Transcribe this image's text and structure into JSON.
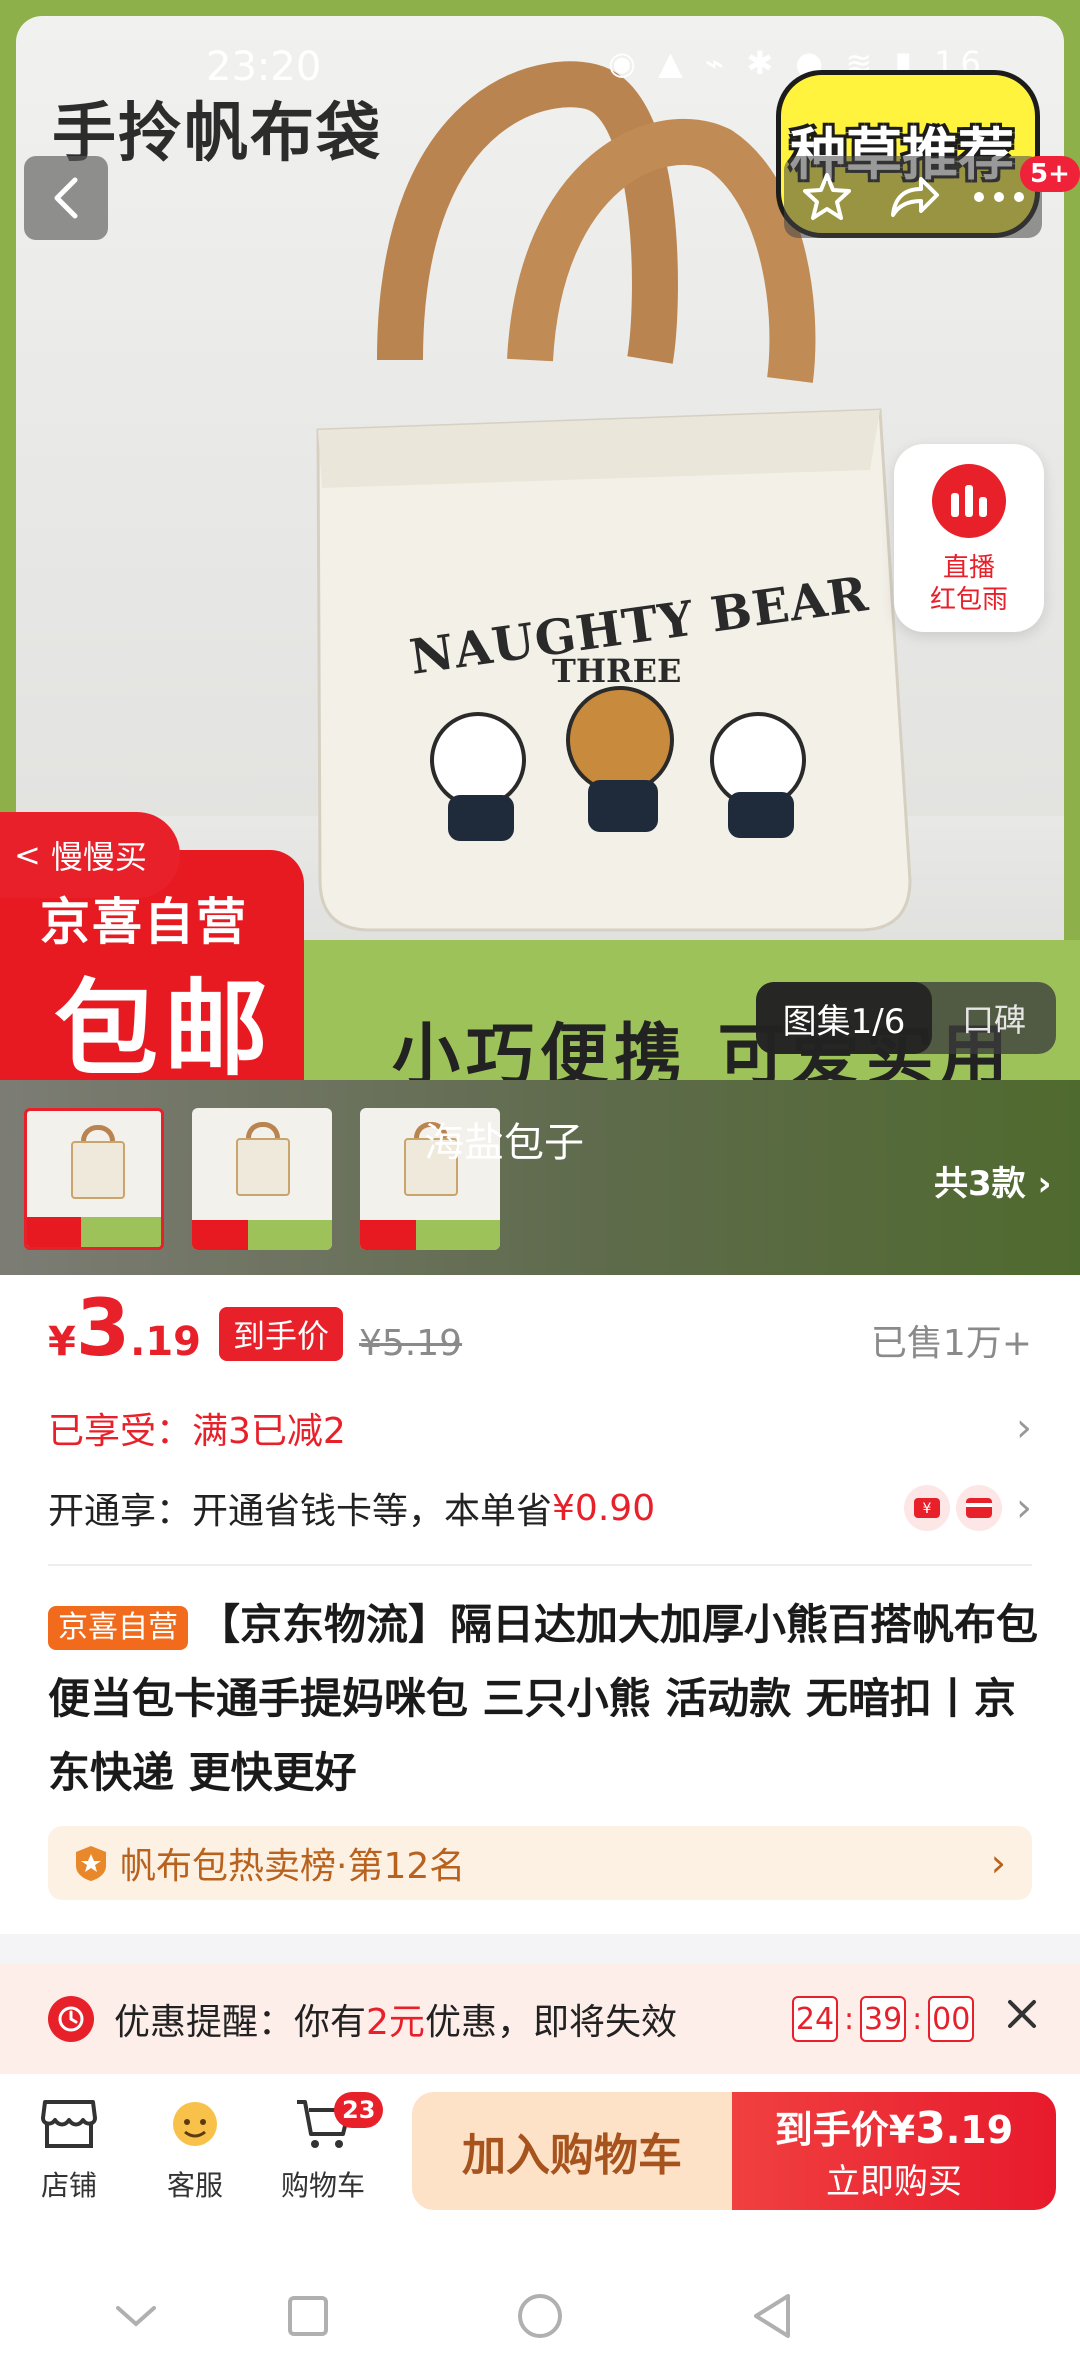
{
  "status_bar": {
    "time": "23:20",
    "battery": "16"
  },
  "hero": {
    "image_title": "手拎帆布袋",
    "bag_print_main": "NAUGHTY BEAR",
    "bag_print_sub": "THREE",
    "bubble_text": "种草推荐",
    "notification_badge": "5+",
    "live_label_line1": "直播",
    "live_label_line2": "红包雨",
    "slow_buy_label": "慢慢买",
    "promo_line1": "京喜自营",
    "promo_line2": "包邮",
    "slogan": "小巧便携 可爱实用",
    "gallery_tab": "图集1/6",
    "reviews_tab": "口碑",
    "variant_name": "海盐包子",
    "variant_count": "共3款"
  },
  "price": {
    "currency": "¥",
    "integer": "3",
    "decimal": ".19",
    "tag": "到手价",
    "original": "¥5.19",
    "sold": "已售1万+"
  },
  "discount_row": {
    "label": "已享受：",
    "text": "满3已减2"
  },
  "member_row": {
    "label": "开通享：",
    "text": "开通省钱卡等，本单省",
    "amount": "¥0.90"
  },
  "product": {
    "store_tag": "京喜自营",
    "title": "【京东物流】隔日达加大加厚小熊百搭帆布包便当包卡通手提妈咪包 三只小熊 活动款 无暗扣丨京东快递 更快更好"
  },
  "rank": {
    "text": "帆布包热卖榜·第12名"
  },
  "reminder": {
    "label": "优惠提醒：",
    "text_before": "你有",
    "amount": "2元",
    "text_after": "优惠，即将失效",
    "hours": "24",
    "minutes": "39",
    "seconds": "00"
  },
  "actions": {
    "store": "店铺",
    "service": "客服",
    "cart": "购物车",
    "cart_count": "23",
    "add_to_cart": "加入购物车",
    "buy_price_label": "到手价¥",
    "buy_price_int": "3",
    "buy_price_dec": ".19",
    "buy_now": "立即购买"
  },
  "colors": {
    "accent_red": "#e8202a",
    "store_tag_orange": "#f26b1d",
    "rank_brown": "#b8621d",
    "hero_green": "#8db04a"
  }
}
